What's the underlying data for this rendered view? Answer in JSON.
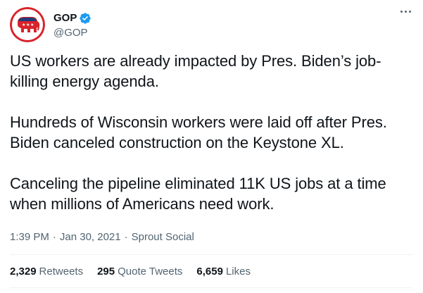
{
  "author": {
    "display_name": "GOP",
    "handle": "@GOP",
    "verified": true,
    "avatar_icon": "republican-elephant-logo",
    "avatar_bg": "#ffffff",
    "avatar_ring": "#d8232a",
    "badge_color": "#1d9bf0"
  },
  "tweet": {
    "paragraphs": [
      "US workers are already impacted by Pres. Biden’s job-killing energy agenda.",
      "Hundreds of Wisconsin workers were laid off after Pres. Biden canceled construction on the Keystone XL.",
      "Canceling the pipeline eliminated 11K US jobs at a time when millions of Americans need work."
    ],
    "time": "1:39 PM",
    "date": "Jan 30, 2021",
    "source": "Sprout Social",
    "separator": "·"
  },
  "stats": {
    "retweets": {
      "count": "2,329",
      "label": "Retweets"
    },
    "quote_tweets": {
      "count": "295",
      "label": "Quote Tweets"
    },
    "likes": {
      "count": "6,659",
      "label": "Likes"
    }
  },
  "icons": {
    "more": "more-horizontal-icon",
    "verified": "verified-badge-icon"
  }
}
